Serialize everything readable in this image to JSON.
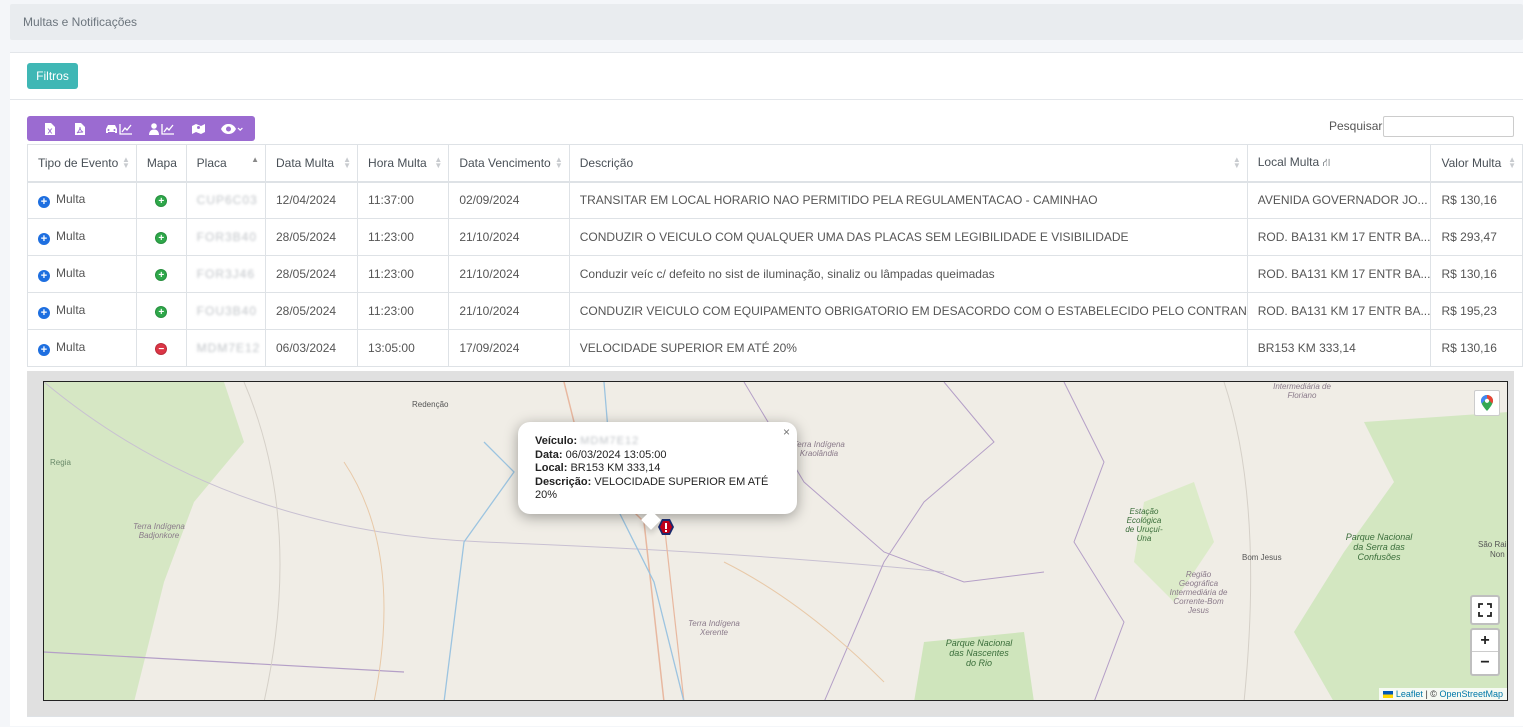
{
  "breadcrumb": "Multas e Notificações",
  "filters_button": "Filtros",
  "toolbar": {
    "icons": [
      "excel-icon",
      "pdf-icon",
      "vehicle-chart-icon",
      "driver-chart-icon",
      "map-icon",
      "visibility-icon"
    ]
  },
  "search": {
    "label": "Pesquisar",
    "value": ""
  },
  "table": {
    "headers": [
      "Tipo de Evento",
      "Mapa",
      "Placa",
      "Data Multa",
      "Hora Multa",
      "Data Vencimento",
      "Descrição",
      "Local Multa",
      "Valor Multa"
    ],
    "rows": [
      {
        "tipo": "Multa",
        "mapa": "add",
        "placa": "CUP6C03",
        "data": "12/04/2024",
        "hora": "11:37:00",
        "vencimento": "02/09/2024",
        "descricao": "TRANSITAR EM LOCAL HORARIO NAO PERMITIDO PELA REGULAMENTACAO - CAMINHAO",
        "local": "AVENIDA GOVERNADOR JO...",
        "valor": "R$ 130,16"
      },
      {
        "tipo": "Multa",
        "mapa": "add",
        "placa": "FOR3B40",
        "data": "28/05/2024",
        "hora": "11:23:00",
        "vencimento": "21/10/2024",
        "descricao": "CONDUZIR O VEICULO COM QUALQUER UMA DAS PLACAS SEM LEGIBILIDADE E VISIBILIDADE",
        "local": "ROD. BA131 KM 17 ENTR BA...",
        "valor": "R$ 293,47"
      },
      {
        "tipo": "Multa",
        "mapa": "add",
        "placa": "FOR3J46",
        "data": "28/05/2024",
        "hora": "11:23:00",
        "vencimento": "21/10/2024",
        "descricao": "Conduzir veíc c/ defeito no sist de iluminação, sinaliz ou lâmpadas queimadas",
        "local": "ROD. BA131 KM 17 ENTR BA...",
        "valor": "R$ 130,16"
      },
      {
        "tipo": "Multa",
        "mapa": "add",
        "placa": "FOU3B40",
        "data": "28/05/2024",
        "hora": "11:23:00",
        "vencimento": "21/10/2024",
        "descricao": "CONDUZIR VEICULO COM EQUIPAMENTO OBRIGATORIO EM DESACORDO COM O ESTABELECIDO PELO CONTRAN",
        "local": "ROD. BA131 KM 17 ENTR BA...",
        "valor": "R$ 195,23"
      },
      {
        "tipo": "Multa",
        "mapa": "remove",
        "placa": "MDM7E12",
        "data": "06/03/2024",
        "hora": "13:05:00",
        "vencimento": "17/09/2024",
        "descricao": "VELOCIDADE SUPERIOR EM ATÉ 20%",
        "local": "BR153 KM 333,14",
        "valor": "R$ 130,16"
      }
    ]
  },
  "popup": {
    "veiculo_label": "Veículo:",
    "veiculo": "MDM7E12",
    "data_label": "Data:",
    "data": "06/03/2024 13:05:00",
    "local_label": "Local:",
    "local": "BR153 KM 333,14",
    "descricao_label": "Descrição:",
    "descricao": "VELOCIDADE SUPERIOR EM ATÉ 20%",
    "close": "×"
  },
  "map": {
    "labels": {
      "redencao": "Redenção",
      "regiao_floriano": "Intermediária de Floriano",
      "terra_kraolandia": "Terra Indígena Kraolândia",
      "terra_badjonkore": "Terra Indígena Badjonkore",
      "estacao_urucui": "Estação Ecológica de Uruçuí-Una",
      "bom_jesus": "Bom Jesus",
      "parque_confusoes": "Parque Nacional da Serra das Confusões",
      "sao_rai": "São Rai",
      "non": "Non",
      "terra_xerente": "Terra Indígena Xerente",
      "regiao_corrente": "Região Geográfica Intermediária de Corrente-Bom Jesus",
      "parque_nascentes": "Parque Nacional das Nascentes do Rio",
      "regia": "Regia"
    },
    "zoom_in": "+",
    "zoom_out": "−",
    "attribution_leaflet": "Leaflet",
    "attribution_sep": "| ©",
    "attribution_osm": "OpenStreetMap",
    "google_label": "Google Maps"
  },
  "colors": {
    "filters": "#3fb7b5",
    "toolbar": "#9b6bd1",
    "expand": "#1e6fe0",
    "add": "#2ea84a",
    "remove": "#dc3545",
    "marker": "#c0001a"
  }
}
